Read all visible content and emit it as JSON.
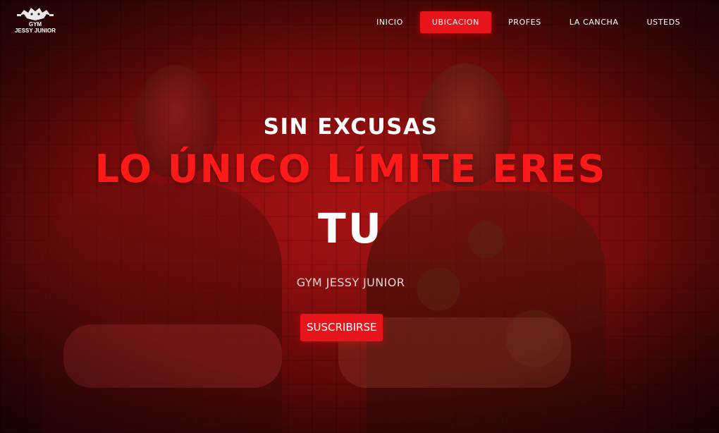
{
  "brand": {
    "logo_icon": "gym-bull-logo-icon",
    "logo_line1": "GYM",
    "logo_line2": "JESSY JUNIOR"
  },
  "nav": {
    "items": [
      {
        "label": "INICIO",
        "active": false
      },
      {
        "label": "UBICACION",
        "active": true
      },
      {
        "label": "PROFES",
        "active": false
      },
      {
        "label": "LA CANCHA",
        "active": false
      },
      {
        "label": "USTEDS",
        "active": false
      }
    ]
  },
  "hero": {
    "kicker": "SIN EXCUSAS",
    "headline": "LO ÚNICO LÍMITE ERES",
    "headline_2": "TU",
    "subtitle": "GYM JESSY JUNIOR",
    "cta_label": "SUSCRIBIRSE"
  },
  "colors": {
    "accent": "#e8141b",
    "headline_red": "#ff1a1a",
    "text_white": "#ffffff"
  }
}
